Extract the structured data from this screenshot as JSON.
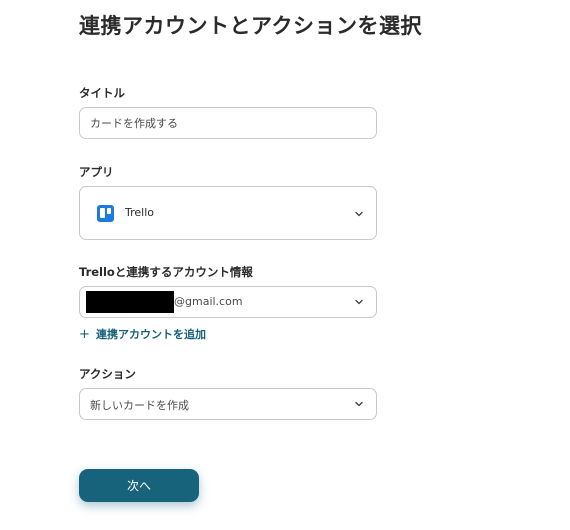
{
  "page_title": "連携アカウントとアクションを選択",
  "title_field": {
    "label": "タイトル",
    "value": "カードを作成する"
  },
  "app_field": {
    "label": "アプリ",
    "app_name": "Trello",
    "icon": "trello-logo",
    "brand_color": "#1d7ae0"
  },
  "account_field": {
    "label": "Trelloと連携するアカウント情報",
    "email_suffix": "@gmail.com",
    "add_account_label": "連携アカウントを追加",
    "add_icon": "plus-icon"
  },
  "action_field": {
    "label": "アクション",
    "value": "新しいカードを作成"
  },
  "next_button": {
    "label": "次へ",
    "color": "#17637c"
  }
}
